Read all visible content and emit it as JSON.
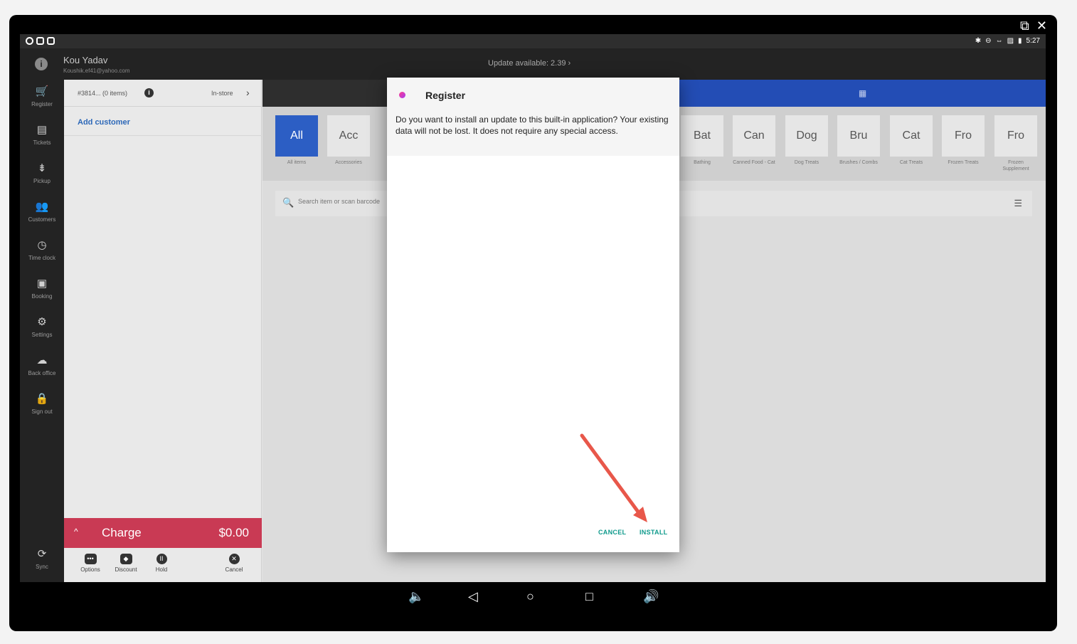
{
  "status_bar": {
    "time": "5:27"
  },
  "header": {
    "user_name": "Kou Yadav",
    "user_email": "Koushik.ef41@yahoo.com",
    "update_text": "Update available: 2.39 ›"
  },
  "sidebar": {
    "items": [
      {
        "label": "Register",
        "icon": "cart-icon",
        "glyph": "🛒"
      },
      {
        "label": "Tickets",
        "icon": "tickets-icon",
        "glyph": "▤"
      },
      {
        "label": "Pickup",
        "icon": "pickup-icon",
        "glyph": "⇟"
      },
      {
        "label": "Customers",
        "icon": "customers-icon",
        "glyph": "👥"
      },
      {
        "label": "Time clock",
        "icon": "clock-icon",
        "glyph": "◷"
      },
      {
        "label": "Booking",
        "icon": "calendar-icon",
        "glyph": "▣"
      },
      {
        "label": "Settings",
        "icon": "gear-icon",
        "glyph": "⚙"
      },
      {
        "label": "Back office",
        "icon": "cloud-icon",
        "glyph": "☁"
      },
      {
        "label": "Sign out",
        "icon": "lock-icon",
        "glyph": "🔒"
      }
    ],
    "sync_label": "Sync"
  },
  "ticket": {
    "number": "#3814... (0 items)",
    "mode": "In-store",
    "add_customer": "Add customer",
    "charge_label": "Charge",
    "charge_amount": "$0.00",
    "actions": [
      "Options",
      "Discount",
      "Hold",
      "Cancel"
    ]
  },
  "categories": [
    {
      "short": "All",
      "name": "All items",
      "active": true
    },
    {
      "short": "Acc",
      "name": "Accessories"
    },
    {
      "short": "Bat",
      "name": "Bathing"
    },
    {
      "short": "Can",
      "name": "Canned Food - Cat"
    },
    {
      "short": "Dog",
      "name": "Dog Treats"
    },
    {
      "short": "Bru",
      "name": "Brushes / Combs"
    },
    {
      "short": "Cat",
      "name": "Cat Treats"
    },
    {
      "short": "Fro",
      "name": "Frozen Treats"
    },
    {
      "short": "Fro",
      "name": "Frozen Supplement"
    }
  ],
  "search": {
    "placeholder": "Search item or scan barcode"
  },
  "dialog": {
    "title": "Register",
    "message": "Do you want to install an update to this built-in application? Your existing data will not be lost. It does not require any special access.",
    "cancel_label": "CANCEL",
    "install_label": "INSTALL"
  },
  "colors": {
    "accent_blue": "#2c5ec4",
    "charge_red": "#c93a54",
    "dialog_button": "#0f9a8c",
    "annotation_arrow": "#e8574a"
  }
}
